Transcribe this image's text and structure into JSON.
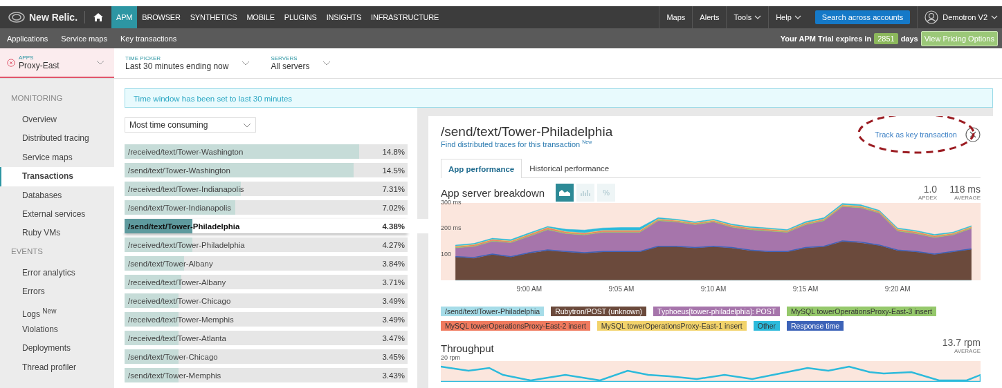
{
  "nav": {
    "brand": "New Relic.",
    "tabs": [
      {
        "label": "APM",
        "selected": true
      },
      {
        "label": "BROWSER",
        "selected": false
      },
      {
        "label": "SYNTHETICS",
        "selected": false
      },
      {
        "label": "MOBILE",
        "selected": false
      },
      {
        "label": "PLUGINS",
        "selected": false
      },
      {
        "label": "INSIGHTS",
        "selected": false
      },
      {
        "label": "INFRASTRUCTURE",
        "selected": false
      }
    ],
    "right_items": [
      {
        "label": "Maps",
        "dropdown": false
      },
      {
        "label": "Alerts",
        "dropdown": false
      },
      {
        "label": "Tools",
        "dropdown": true
      },
      {
        "label": "Help",
        "dropdown": true
      }
    ],
    "search_button": "Search across accounts",
    "user": "Demotron V2"
  },
  "subnav": {
    "items": [
      "Applications",
      "Service maps",
      "Key transactions"
    ],
    "trial_text": "Your APM Trial expires in",
    "trial_days": "2851",
    "days_label": "days",
    "pricing_button": "View Pricing Options"
  },
  "filters": [
    {
      "kind": "app",
      "label": "APPS",
      "value": "Proxy-East"
    },
    {
      "kind": "time",
      "label": "TIME PICKER",
      "value": "Last 30 minutes ending now"
    },
    {
      "kind": "servers",
      "label": "SERVERS",
      "value": "All servers"
    }
  ],
  "sidebar": {
    "sections": [
      {
        "title": "MONITORING",
        "items": [
          {
            "label": "Overview",
            "selected": false
          },
          {
            "label": "Distributed tracing",
            "selected": false
          },
          {
            "label": "Service maps",
            "selected": false
          },
          {
            "label": "Transactions",
            "selected": true
          },
          {
            "label": "Databases",
            "selected": false
          },
          {
            "label": "External services",
            "selected": false
          },
          {
            "label": "Ruby VMs",
            "selected": false
          }
        ]
      },
      {
        "title": "EVENTS",
        "items": [
          {
            "label": "Error analytics",
            "selected": false
          },
          {
            "label": "Errors",
            "selected": false
          },
          {
            "label": "Logs $^{New}$",
            "selected": false
          },
          {
            "label": "Violations",
            "selected": false
          },
          {
            "label": "Deployments",
            "selected": false
          },
          {
            "label": "Thread profiler",
            "selected": false
          }
        ]
      }
    ]
  },
  "banner": "Time window has been set to last 30 minutes",
  "sort_select": {
    "value": "Most time consuming"
  },
  "transactions": [
    {
      "name": "/received/text/Tower-Washington",
      "percent": "14.8%",
      "level": 0.83,
      "selected": false
    },
    {
      "name": "/send/text/Tower-Washington",
      "percent": "14.5%",
      "level": 0.81,
      "selected": false
    },
    {
      "name": "/received/text/Tower-Indianapolis",
      "percent": "7.31%",
      "level": 0.41,
      "selected": false
    },
    {
      "name": "/send/text/Tower-Indianapolis",
      "percent": "7.02%",
      "level": 0.39,
      "selected": false
    },
    {
      "name": "/send/text/Tower-Philadelphia",
      "percent": "4.38%",
      "level": 0.24,
      "selected": true
    },
    {
      "name": "/received/text/Tower-Philadelphia",
      "percent": "4.27%",
      "level": 0.24,
      "selected": false
    },
    {
      "name": "/send/text/Tower-Albany",
      "percent": "3.84%",
      "level": 0.21,
      "selected": false
    },
    {
      "name": "/received/text/Tower-Albany",
      "percent": "3.71%",
      "level": 0.2,
      "selected": false
    },
    {
      "name": "/received/text/Tower-Chicago",
      "percent": "3.49%",
      "level": 0.19,
      "selected": false
    },
    {
      "name": "/received/text/Tower-Memphis",
      "percent": "3.49%",
      "level": 0.19,
      "selected": false
    },
    {
      "name": "/received/text/Tower-Atlanta",
      "percent": "3.47%",
      "level": 0.19,
      "selected": false
    },
    {
      "name": "/send/text/Tower-Chicago",
      "percent": "3.45%",
      "level": 0.19,
      "selected": false
    },
    {
      "name": "/send/text/Tower-Memphis",
      "percent": "3.43%",
      "level": 0.19,
      "selected": false
    }
  ],
  "detail": {
    "title": "/send/text/Tower-Philadelphia",
    "traces_link": "Find distributed traces for this transaction $^{New}$",
    "track_link": "Track as key transaction",
    "tabs": [
      {
        "label": "App performance",
        "selected": true
      },
      {
        "label": "Historical performance",
        "selected": false
      }
    ],
    "breakdown": {
      "title": "App server breakdown",
      "views": [
        {
          "kind": "area",
          "selected": true
        },
        {
          "kind": "bars",
          "selected": false
        },
        {
          "kind": "percent",
          "label": "%",
          "selected": false
        }
      ],
      "apdex": "1.0",
      "apdex_label": "APDEX",
      "average": "118 ms",
      "average_label": "AVERAGE",
      "chart_data": {
        "type": "area",
        "stacked": true,
        "categories": [
          null,
          null,
          null,
          null,
          "9:00 AM",
          null,
          null,
          null,
          null,
          "9:05 AM",
          null,
          null,
          null,
          null,
          "9:10 AM",
          null,
          null,
          null,
          null,
          "9:15 AM",
          null,
          null,
          null,
          null,
          "9:20 AM",
          null,
          null,
          null,
          null
        ],
        "ylim": [
          0,
          300
        ],
        "yticks": [
          {
            "value": 100,
            "label": "100"
          },
          {
            "value": 200,
            "label": "200 ms"
          },
          {
            "value": 300,
            "label": "300 ms"
          }
        ],
        "series": [
          {
            "name": "/send/text/Tower-Philadelphia",
            "color": "#a6dce8",
            "values": [
              1,
              1,
              1,
              1,
              1,
              1,
              1,
              1,
              1,
              1,
              1,
              1,
              1,
              1,
              1,
              1,
              1,
              1,
              1,
              1,
              1,
              1,
              1,
              1,
              1,
              1,
              1,
              1,
              1
            ]
          },
          {
            "name": "Rubytron/POST (unknown)",
            "color": "#6b4a3c",
            "values": [
              90,
              85,
              100,
              90,
              105,
              115,
              110,
              105,
              110,
              110,
              110,
              130,
              130,
              125,
              130,
              125,
              115,
              110,
              110,
              125,
              130,
              150,
              145,
              135,
              115,
              110,
              100,
              110,
              120
            ]
          },
          {
            "name": "Typhoeus[tower-philadelphia]: POST",
            "color": "#a675ab",
            "values": [
              35,
              45,
              50,
              55,
              65,
              80,
              70,
              70,
              75,
              75,
              75,
              100,
              95,
              90,
              95,
              80,
              80,
              80,
              75,
              90,
              100,
              135,
              135,
              125,
              75,
              70,
              65,
              65,
              80
            ]
          },
          {
            "name": "MySQL towerOperationsProxy-East-3 insert",
            "color": "#95c86b",
            "values": [
              3,
              3,
              3,
              3,
              3,
              3,
              3,
              3,
              3,
              3,
              3,
              3,
              3,
              3,
              3,
              3,
              3,
              3,
              3,
              3,
              3,
              3,
              3,
              3,
              3,
              3,
              3,
              3,
              3
            ]
          },
          {
            "name": "MySQL towerOperationsProxy-East-2 insert",
            "color": "#f07a5e",
            "values": [
              3,
              4,
              4,
              3,
              4,
              5,
              4,
              4,
              4,
              4,
              4,
              3,
              3,
              3,
              3,
              4,
              4,
              4,
              3,
              3,
              3,
              3,
              3,
              3,
              4,
              4,
              4,
              3,
              3
            ]
          },
          {
            "name": "MySQL towerOperationsProxy-East-1 insert",
            "color": "#f2d36b",
            "values": [
              2,
              2,
              2,
              2,
              2,
              2,
              2,
              2,
              2,
              2,
              2,
              2,
              2,
              2,
              2,
              2,
              2,
              2,
              2,
              2,
              2,
              2,
              2,
              2,
              2,
              2,
              2,
              2,
              2
            ]
          },
          {
            "name": "Other",
            "color": "#2cbadb",
            "values": [
              3,
              3,
              3,
              4,
              4,
              3,
              8,
              10,
              8,
              10,
              10,
              4,
              3,
              3,
              3,
              3,
              3,
              3,
              3,
              4,
              4,
              4,
              4,
              3,
              3,
              3,
              3,
              3,
              3
            ]
          },
          {
            "name": "Response time",
            "color": "#3d63b8",
            "type": "line",
            "values": [
              92,
              88,
              102,
              92,
              107,
              118,
              112,
              107,
              112,
              112,
              112,
              132,
              132,
              127,
              132,
              127,
              117,
              112,
              112,
              127,
              132,
              153,
              148,
              137,
              117,
              112,
              102,
              112,
              122
            ]
          }
        ]
      }
    },
    "throughput": {
      "title": "Throughput",
      "value": "13.7 rpm",
      "value_label": "AVERAGE",
      "axis_label": "20 rpm"
    }
  }
}
